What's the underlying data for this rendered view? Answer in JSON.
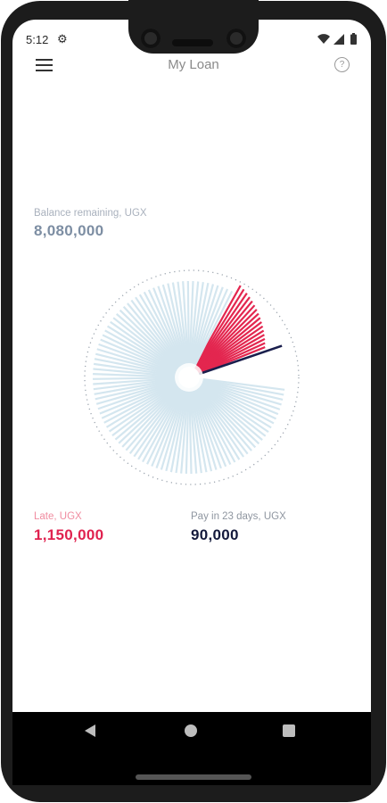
{
  "status_bar": {
    "time": "5:12",
    "gear_icon": "gear-icon",
    "wifi_icon": "wifi-icon",
    "signal_icon": "signal-icon",
    "battery_icon": "battery-icon"
  },
  "header": {
    "title": "My Loan",
    "menu_icon": "hamburger-menu-icon",
    "help_icon": "help-icon",
    "help_glyph": "?"
  },
  "balance": {
    "label": "Balance remaining, UGX",
    "value": "8,080,000",
    "color": "#7d8ea3"
  },
  "late": {
    "label": "Late, UGX",
    "value": "1,150,000",
    "label_color": "#f08ca0",
    "value_color": "#e0224f"
  },
  "next_payment": {
    "label": "Pay in 23 days, UGX",
    "value": "90,000",
    "color": "#141a3c"
  },
  "navigation": {
    "back_icon": "back-icon",
    "home_icon": "home-icon",
    "recents_icon": "recents-icon"
  },
  "chart_data": {
    "type": "radial-bar",
    "segments": [
      {
        "name": "Late",
        "amount": 1150000,
        "color": "#e3264f"
      },
      {
        "name": "Due",
        "amount": 90000,
        "color": "#1a1f4d"
      },
      {
        "name": "Remaining",
        "amount": 8080000,
        "color": "#d4e6ef"
      }
    ]
  }
}
